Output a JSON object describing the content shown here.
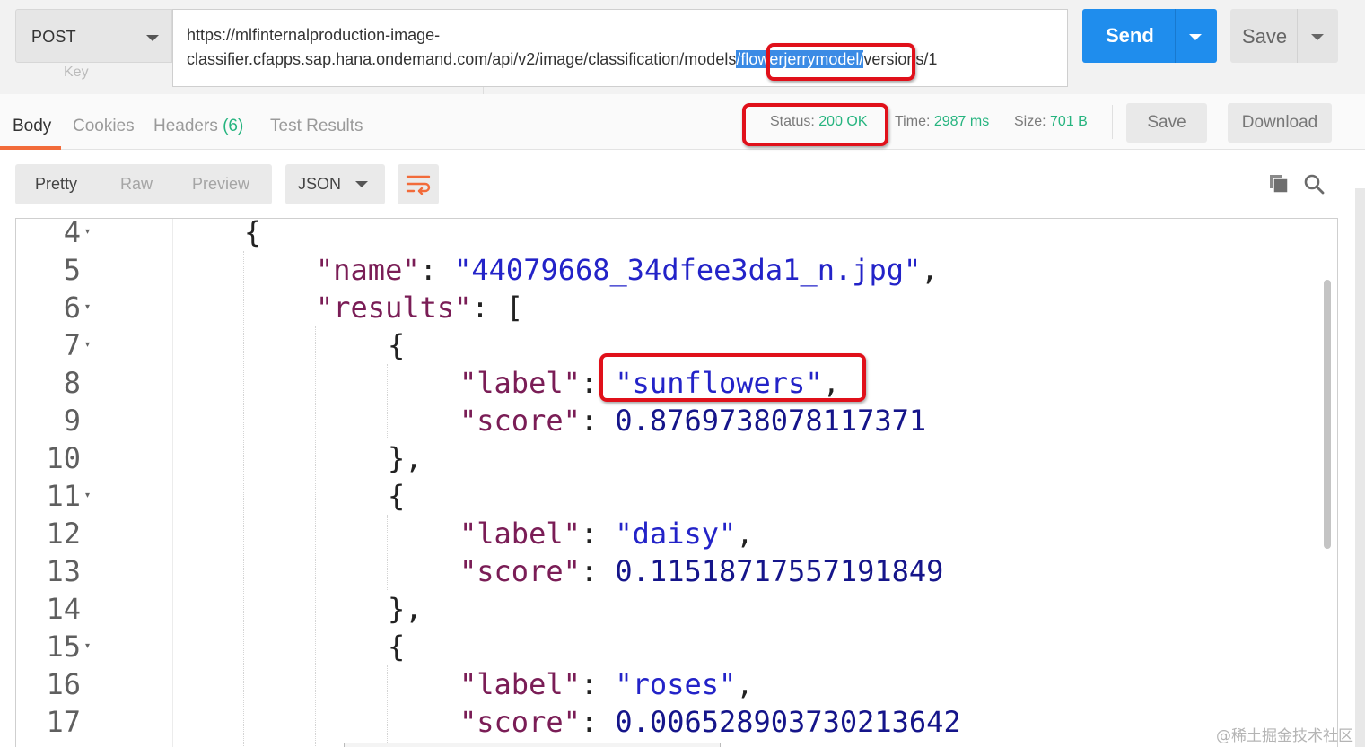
{
  "request": {
    "method": "POST",
    "url_line1": "https://mlfinternalproduction-image-",
    "url_line2_prefix": "classifier.cfapps.sap.hana.ondemand.com/api/v2/image/classification/models",
    "url_line2_sep1": "/",
    "url_highlight": "flowerjerrymodel",
    "url_line2_sep2": "/",
    "url_line2_suffix": "versions/1",
    "hidden_key_label": "Key",
    "send_label": "Send",
    "save_label": "Save"
  },
  "response_tabs": {
    "body": "Body",
    "cookies": "Cookies",
    "headers_label": "Headers",
    "headers_count": "(6)",
    "test_results": "Test Results"
  },
  "response_meta": {
    "status_label": "Status:",
    "status_value": "200 OK",
    "time_label": "Time:",
    "time_value": "2987 ms",
    "size_label": "Size:",
    "size_value": "701 B",
    "save_label": "Save",
    "download_label": "Download"
  },
  "body_toolbar": {
    "pretty": "Pretty",
    "raw": "Raw",
    "preview": "Preview",
    "format": "JSON"
  },
  "code": {
    "line_numbers": [
      "4",
      "5",
      "6",
      "7",
      "8",
      "9",
      "10",
      "11",
      "12",
      "13",
      "14",
      "15",
      "16",
      "17"
    ],
    "l4": "{",
    "l5_key": "\"name\"",
    "l5_colon": ": ",
    "l5_val": "\"44079668_34dfee3da1_n.jpg\"",
    "l5_end": ",",
    "l6_key": "\"results\"",
    "l6_rest": ": [",
    "l7": "{",
    "l8_key": "\"label\"",
    "l8_colon": ": ",
    "l8_val": "\"sunflowers\"",
    "l8_end": ",",
    "l9_key": "\"score\"",
    "l9_colon": ": ",
    "l9_val": "0.8769738078117371",
    "l10": "},",
    "l11": "{",
    "l12_key": "\"label\"",
    "l12_colon": ": ",
    "l12_val": "\"daisy\"",
    "l12_end": ",",
    "l13_key": "\"score\"",
    "l13_colon": ": ",
    "l13_val": "0.11518717557191849",
    "l14": "},",
    "l15": "{",
    "l16_key": "\"label\"",
    "l16_colon": ": ",
    "l16_val": "\"roses\"",
    "l16_end": ",",
    "l17_key": "\"score\"",
    "l17_colon": ": ",
    "l17_val": "0.006528903730213642"
  },
  "watermark": "@稀土掘金技术社区",
  "colors": {
    "send_button": "#1f8ded",
    "status_green": "#26b47f",
    "active_tab_underline": "#f26b3a",
    "annotation_red": "#e0101a",
    "json_key": "#7a1d56",
    "json_string": "#2323c8"
  },
  "icons": [
    "method-dropdown-icon",
    "send-dropdown-icon",
    "save-dropdown-icon",
    "format-dropdown-icon",
    "wrap-lines-icon",
    "copy-icon",
    "search-icon",
    "fold-arrow-icon"
  ]
}
